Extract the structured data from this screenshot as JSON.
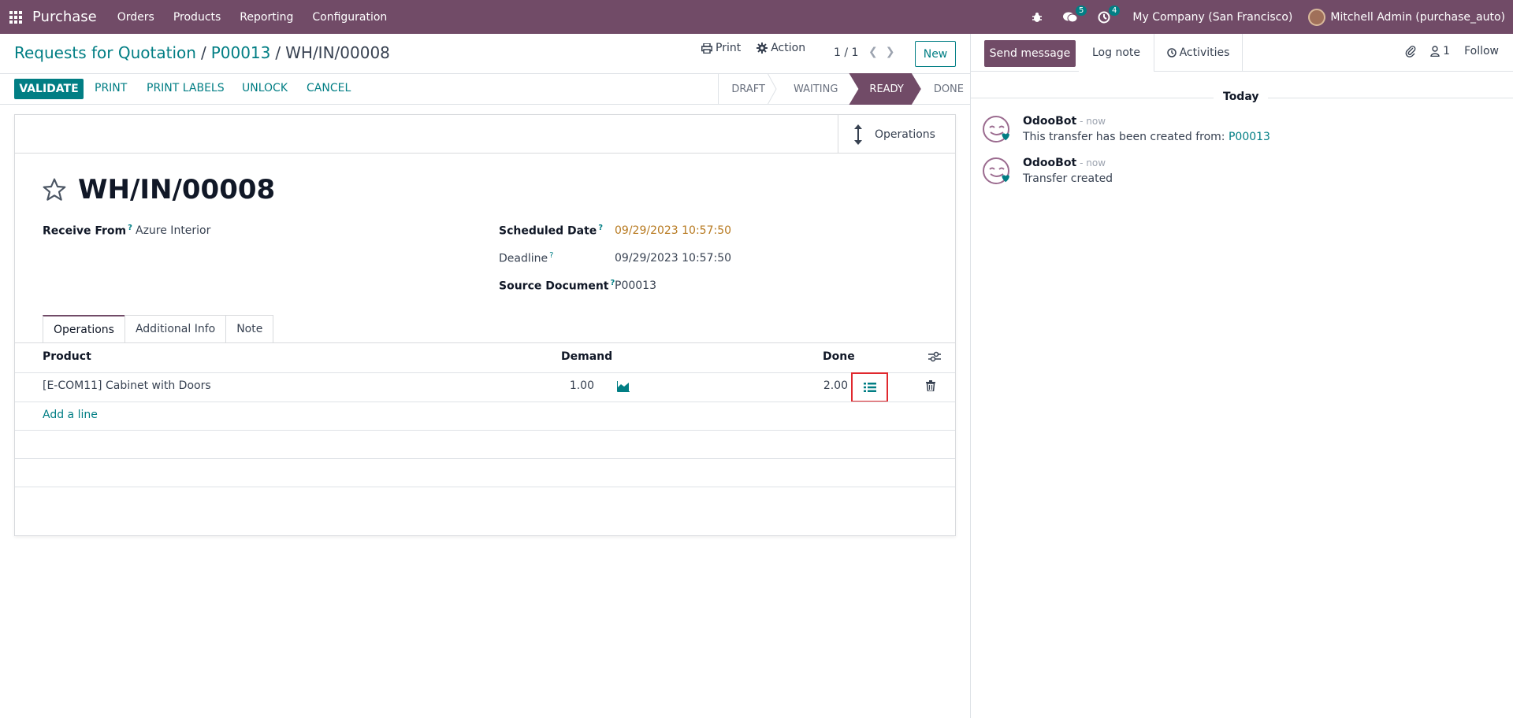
{
  "navbar": {
    "brand": "Purchase",
    "menu": [
      "Orders",
      "Products",
      "Reporting",
      "Configuration"
    ],
    "messages_badge": "5",
    "activities_badge": "4",
    "company": "My Company (San Francisco)",
    "user": "Mitchell Admin (purchase_auto)"
  },
  "breadcrumb": {
    "root": "Requests for Quotation",
    "sep": "/",
    "parent": "P00013",
    "current": "WH/IN/00008"
  },
  "control": {
    "print": "Print",
    "action": "Action",
    "pager": "1 / 1",
    "new": "New"
  },
  "header_buttons": {
    "validate": "VALIDATE",
    "print": "PRINT",
    "print_labels": "PRINT LABELS",
    "unlock": "UNLOCK",
    "cancel": "CANCEL"
  },
  "stages": [
    "DRAFT",
    "WAITING",
    "READY",
    "DONE"
  ],
  "active_stage": "READY",
  "form": {
    "smart_button": "Operations",
    "title": "WH/IN/00008",
    "receive_from_label": "Receive From",
    "receive_from": "Azure Interior",
    "scheduled_date_label": "Scheduled Date",
    "scheduled_date": "09/29/2023 10:57:50",
    "deadline_label": "Deadline",
    "deadline": "09/29/2023 10:57:50",
    "source_document_label": "Source Document",
    "source_document": "P00013",
    "help_mark": "?"
  },
  "tabs": [
    "Operations",
    "Additional Info",
    "Note"
  ],
  "table": {
    "headers": {
      "product": "Product",
      "demand": "Demand",
      "done": "Done"
    },
    "rows": [
      {
        "product": "[E-COM11] Cabinet with Doors",
        "demand": "1.00",
        "done": "2.00"
      }
    ],
    "add_line": "Add a line"
  },
  "chatter": {
    "send_message": "Send message",
    "log_note": "Log note",
    "activities": "Activities",
    "followers_count": "1",
    "follow": "Follow",
    "day": "Today",
    "messages": [
      {
        "author": "OdooBot",
        "date": "- now",
        "body": "This transfer has been created from:",
        "link": "P00013"
      },
      {
        "author": "OdooBot",
        "date": "- now",
        "body": "Transfer created",
        "link": ""
      }
    ]
  },
  "colors": {
    "brand": "#714b67",
    "accent": "#017e84",
    "highlight_box": "#e0282e",
    "scheduled_date": "#b7791f"
  }
}
